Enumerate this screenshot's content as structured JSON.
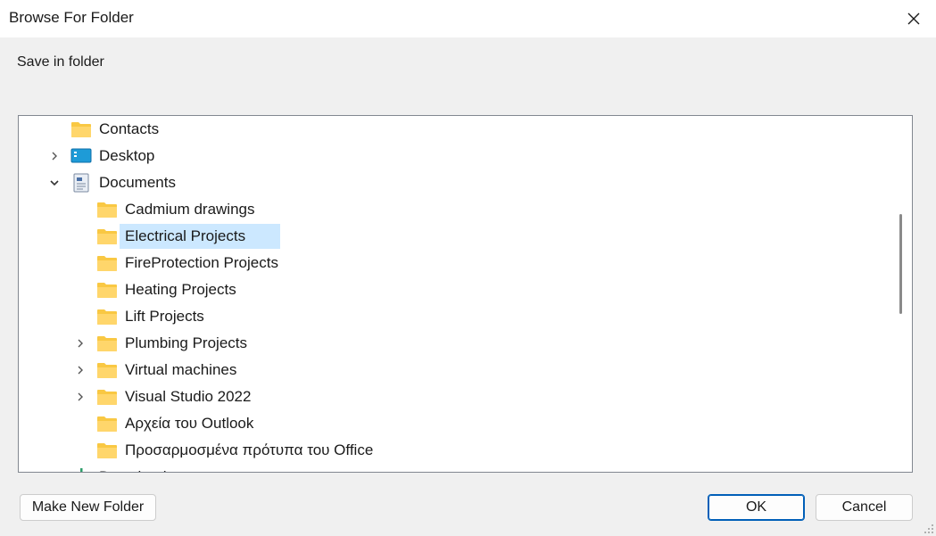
{
  "window": {
    "title": "Browse For Folder"
  },
  "prompt": "Save in folder",
  "tree": {
    "items": [
      {
        "label": "Contacts",
        "icon": "folder-icon",
        "expander": "none"
      },
      {
        "label": "Desktop",
        "icon": "desktop-icon",
        "expander": "collapsed"
      },
      {
        "label": "Documents",
        "icon": "documents-icon",
        "expander": "expanded"
      },
      {
        "label": "Cadmium drawings",
        "icon": "folder-icon",
        "expander": "none"
      },
      {
        "label": "Electrical Projects",
        "icon": "folder-icon",
        "expander": "none",
        "selected": true
      },
      {
        "label": "FireProtection Projects",
        "icon": "folder-icon",
        "expander": "none"
      },
      {
        "label": "Heating Projects",
        "icon": "folder-icon",
        "expander": "none"
      },
      {
        "label": "Lift Projects",
        "icon": "folder-icon",
        "expander": "none"
      },
      {
        "label": "Plumbing Projects",
        "icon": "folder-icon",
        "expander": "collapsed"
      },
      {
        "label": "Virtual machines",
        "icon": "folder-icon",
        "expander": "collapsed"
      },
      {
        "label": "Visual Studio 2022",
        "icon": "folder-icon",
        "expander": "collapsed"
      },
      {
        "label": "Αρχεία του Outlook",
        "icon": "folder-icon",
        "expander": "none"
      },
      {
        "label": "Προσαρμοσμένα πρότυπα του Office",
        "icon": "folder-icon",
        "expander": "none"
      },
      {
        "label": "Downloads",
        "icon": "downloads-icon",
        "expander": "collapsed"
      }
    ]
  },
  "buttons": {
    "make_new_folder": "Make New Folder",
    "ok": "OK",
    "cancel": "Cancel"
  },
  "colors": {
    "selection": "#cce8ff",
    "folder": "#ffc83d",
    "primary_border": "#005fb8"
  }
}
